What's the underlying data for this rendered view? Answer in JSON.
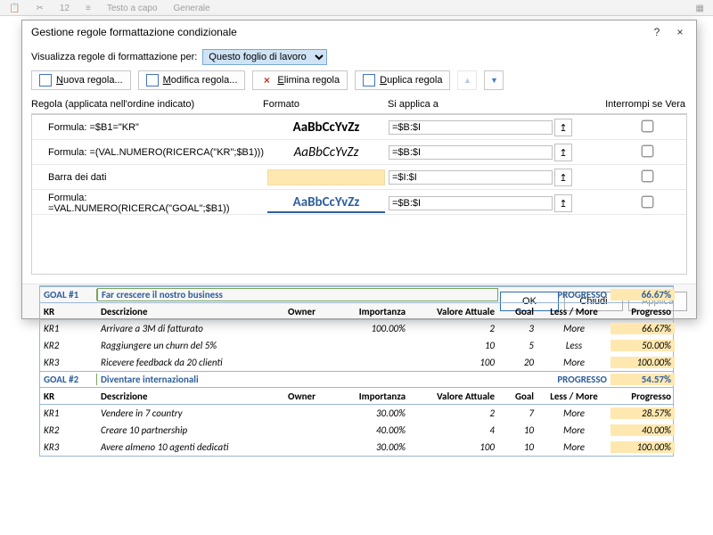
{
  "ribbon": {
    "text_wrap": "Testo a capo",
    "number_group": "Generale"
  },
  "dialog": {
    "title": "Gestione regole formattazione condizionale",
    "help": "?",
    "close": "×",
    "show_label": "Visualizza regole di formattazione per:",
    "show_value": "Questo foglio di lavoro",
    "toolbar": {
      "new_rule": "Nuova regola...",
      "new_rule_accel": "N",
      "edit_rule": "Modifica regola...",
      "edit_rule_accel": "M",
      "delete_rule": "Elimina regola",
      "delete_rule_accel": "E",
      "dup_rule": "Duplica regola",
      "dup_rule_accel": "D"
    },
    "headers": {
      "rule": "Regola (applicata nell'ordine indicato)",
      "format": "Formato",
      "applies": "Si applica a",
      "stop": "Interrompi se Vera"
    },
    "preview_text": "AaBbCcYvZz",
    "rules": [
      {
        "label": "Formula: =$B1=\"KR\"",
        "fmt": "bold",
        "applies": "=$B:$I"
      },
      {
        "label": "Formula: =(VAL.NUMERO(RICERCA(\"KR\";$B1)))",
        "fmt": "italic",
        "applies": "=$B:$I"
      },
      {
        "label": "Barra dei dati",
        "fmt": "bar",
        "applies": "=$I:$I"
      },
      {
        "label": "Formula: =VAL.NUMERO(RICERCA(\"GOAL\";$B1))",
        "fmt": "blue",
        "applies": "=$B:$I"
      }
    ],
    "buttons": {
      "ok": "OK",
      "close_btn": "Chiudi",
      "apply": "Applica"
    }
  },
  "sheet": {
    "headers": {
      "kr": "KR",
      "descr": "Descrizione",
      "owner": "Owner",
      "imp": "Importanza",
      "val": "Valore Attuale",
      "goal": "Goal",
      "lm": "Less / More",
      "prog": "Progresso"
    },
    "prog_label": "PROGRESSO",
    "goals": [
      {
        "id": "GOAL #1",
        "title": "Far crescere il nostro business",
        "progress": "66.67%",
        "rows": [
          {
            "kr": "KR1",
            "descr": "Arrivare a 3M di fatturato",
            "imp": "100.00%",
            "val": "2",
            "goal": "3",
            "lm": "More",
            "prog": "66.67%"
          },
          {
            "kr": "KR2",
            "descr": "Raggiungere un churn del 5%",
            "imp": "",
            "val": "10",
            "goal": "5",
            "lm": "Less",
            "prog": "50.00%"
          },
          {
            "kr": "KR3",
            "descr": "Ricevere feedback da 20 clienti",
            "imp": "",
            "val": "100",
            "goal": "20",
            "lm": "More",
            "prog": "100.00%"
          }
        ]
      },
      {
        "id": "GOAL #2",
        "title": "Diventare internazionali",
        "progress": "54.57%",
        "rows": [
          {
            "kr": "KR1",
            "descr": "Vendere in 7 country",
            "imp": "30.00%",
            "val": "2",
            "goal": "7",
            "lm": "More",
            "prog": "28.57%"
          },
          {
            "kr": "KR2",
            "descr": "Creare 10 partnership",
            "imp": "40.00%",
            "val": "4",
            "goal": "10",
            "lm": "More",
            "prog": "40.00%"
          },
          {
            "kr": "KR3",
            "descr": "Avere almeno 10 agenti dedicati",
            "imp": "30.00%",
            "val": "100",
            "goal": "10",
            "lm": "More",
            "prog": "100.00%"
          }
        ]
      }
    ]
  }
}
